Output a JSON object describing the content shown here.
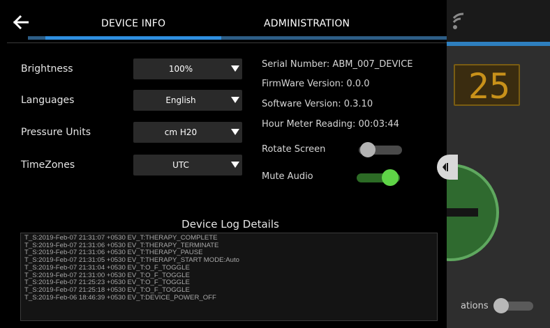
{
  "background_app": {
    "counter_value": "25",
    "notifications_label": "ations",
    "notifications_enabled": false
  },
  "header": {
    "tabs": [
      {
        "label": "DEVICE INFO",
        "active": true
      },
      {
        "label": "ADMINISTRATION",
        "active": false
      }
    ]
  },
  "settings": {
    "brightness": {
      "label": "Brightness",
      "value": "100%"
    },
    "languages": {
      "label": "Languages",
      "value": "English"
    },
    "pressure_units": {
      "label": "Pressure Units",
      "value": "cm H20"
    },
    "timezones": {
      "label": "TimeZones",
      "value": "UTC"
    }
  },
  "device_info": {
    "serial_number": "Serial Number: ABM_007_DEVICE",
    "firmware_version": "FirmWare Version: 0.0.0",
    "software_version": "Software Version: 0.3.10",
    "hour_meter": "Hour Meter Reading: 00:03:44",
    "rotate_screen": {
      "label": "Rotate Screen",
      "enabled": false
    },
    "mute_audio": {
      "label": "Mute Audio",
      "enabled": true
    }
  },
  "log": {
    "title": "Device Log Details",
    "entries": [
      "T_S:2019-Feb-07 21:31:07 +0530 EV_T:THERAPY_COMPLETE",
      "T_S:2019-Feb-07 21:31:06 +0530 EV_T:THERAPY_TERMINATE",
      "T_S:2019-Feb-07 21:31:06 +0530 EV_T:THERAPY_PAUSE",
      "T_S:2019-Feb-07 21:31:05 +0530 EV_T:THERAPY_START MODE:Auto",
      "T_S:2019-Feb-07 21:31:04 +0530 EV_T:O_F_TOGGLE",
      "T_S:2019-Feb-07 21:31:00 +0530 EV_T:O_F_TOGGLE",
      "T_S:2019-Feb-07 21:25:23 +0530 EV_T:O_F_TOGGLE",
      "T_S:2019-Feb-07 21:25:18 +0530 EV_T:O_F_TOGGLE",
      "T_S:2019-Feb-06 18:46:39 +0530 EV_T:DEVICE_POWER_OFF"
    ]
  },
  "colors": {
    "accent_blue": "#2f8fe0",
    "toggle_on_green": "#5fd447",
    "counter_amber": "#c8911a"
  }
}
